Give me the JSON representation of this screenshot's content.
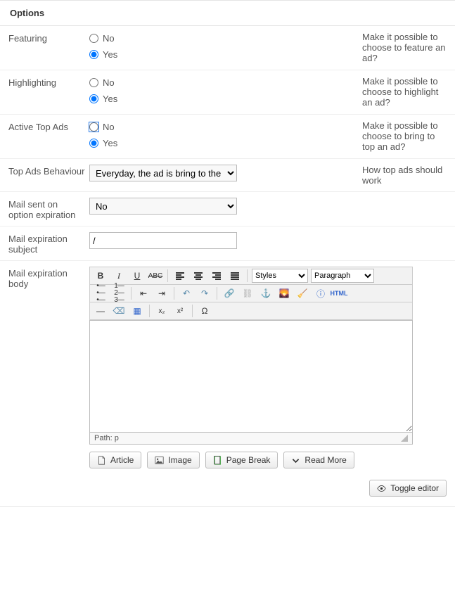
{
  "section": {
    "title": "Options"
  },
  "rows": {
    "featuring": {
      "label": "Featuring",
      "opt_no": "No",
      "opt_yes": "Yes",
      "hint": "Make it possible to choose to feature an ad?"
    },
    "highlighting": {
      "label": "Highlighting",
      "opt_no": "No",
      "opt_yes": "Yes",
      "hint": "Make it possible to choose to highlight an ad?"
    },
    "active_top": {
      "label": "Active Top Ads",
      "opt_no": "No",
      "opt_yes": "Yes",
      "hint": "Make it possible to choose to bring to top an ad?"
    },
    "top_behaviour": {
      "label": "Top Ads Behaviour",
      "value": "Everyday, the ad is bring to the",
      "hint": "How top ads should work"
    },
    "mail_sent": {
      "label": "Mail sent on option expiration",
      "value": "No"
    },
    "mail_subject": {
      "label": "Mail expiration subject",
      "value": "/"
    },
    "mail_body": {
      "label": "Mail expiration body"
    }
  },
  "editor": {
    "styles_select": "Styles",
    "format_select": "Paragraph",
    "path": "Path: p",
    "html_btn": "HTML"
  },
  "buttons": {
    "article": "Article",
    "image": "Image",
    "pagebreak": "Page Break",
    "readmore": "Read More",
    "toggle": "Toggle editor"
  }
}
